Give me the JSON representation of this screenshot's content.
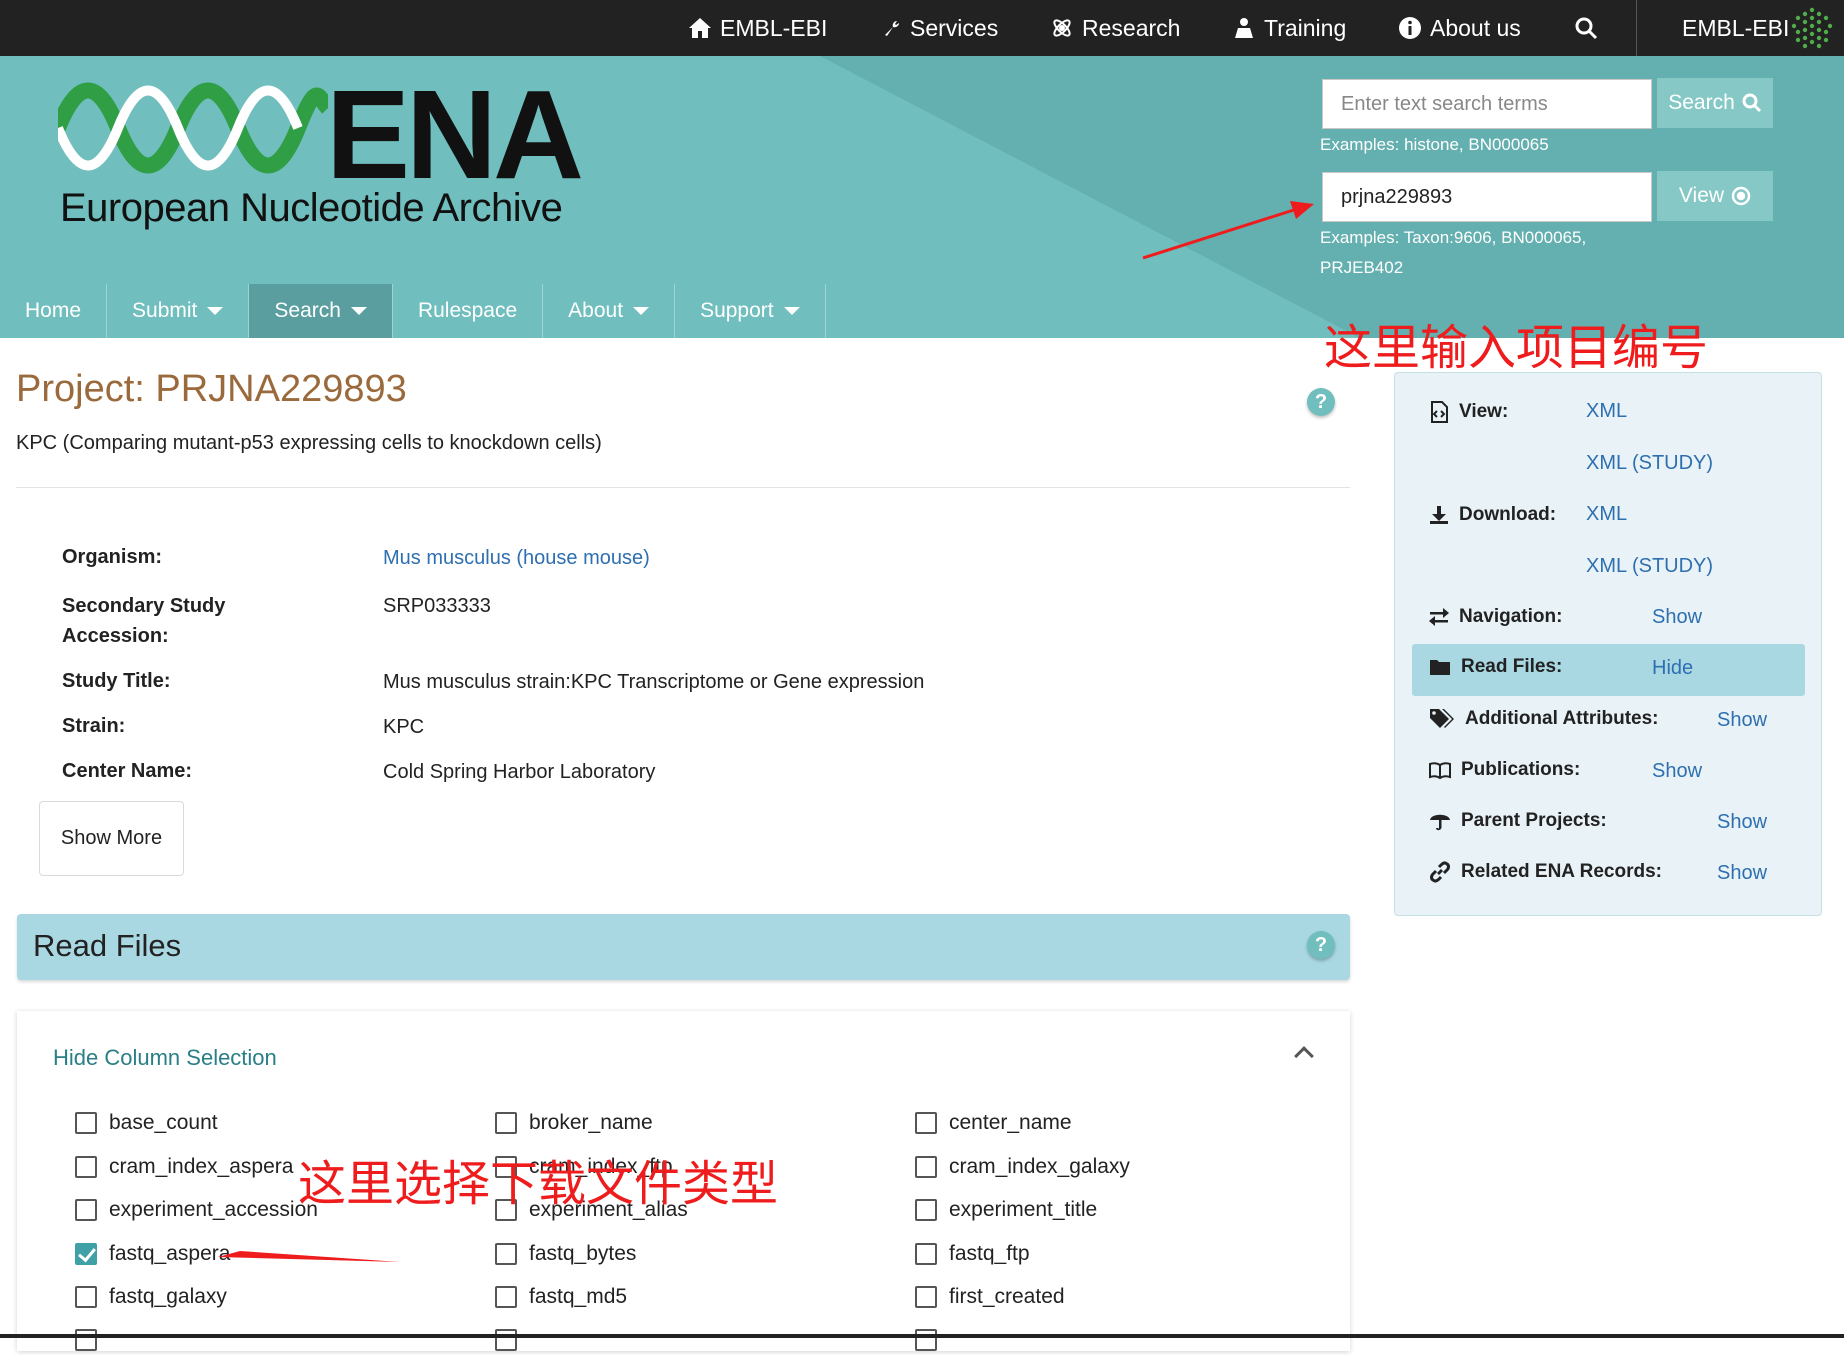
{
  "topbar": {
    "items": [
      {
        "label": "EMBL-EBI",
        "icon": "home-icon"
      },
      {
        "label": "Services",
        "icon": "wrench-icon"
      },
      {
        "label": "Research",
        "icon": "atom-icon"
      },
      {
        "label": "Training",
        "icon": "trainer-icon"
      },
      {
        "label": "About us",
        "icon": "info-icon"
      }
    ],
    "search_icon": "search-icon",
    "brand": "EMBL-EBI"
  },
  "masthead": {
    "logo_text": "ENA",
    "logo_subtitle": "European Nucleotide Archive",
    "search": {
      "placeholder": "Enter text search terms",
      "value": "",
      "button": "Search",
      "examples": "Examples: histone, BN000065"
    },
    "view": {
      "value": "prjna229893",
      "button": "View",
      "examples_line1": "Examples: Taxon:9606, BN000065,",
      "examples_line2": "PRJEB402"
    },
    "nav": [
      {
        "label": "Home",
        "dropdown": false
      },
      {
        "label": "Submit",
        "dropdown": true
      },
      {
        "label": "Search",
        "dropdown": true,
        "active": true
      },
      {
        "label": "Rulespace",
        "dropdown": false
      },
      {
        "label": "About",
        "dropdown": true
      },
      {
        "label": "Support",
        "dropdown": true
      }
    ]
  },
  "annotations": {
    "project_input": "这里输入项目编号",
    "file_type": "这里选择下载文件类型",
    "color": "#ee1c1c"
  },
  "project": {
    "title": "Project: PRJNA229893",
    "description": "KPC (Comparing mutant-p53 expressing cells to knockdown cells)",
    "details": [
      {
        "label": "Organism:",
        "value": "Mus musculus (house mouse)",
        "link": true
      },
      {
        "label_line1": "Secondary Study",
        "label_line2": "Accession:",
        "value": "SRP033333"
      },
      {
        "label": "Study Title:",
        "value": "Mus musculus strain:KPC Transcriptome or Gene expression"
      },
      {
        "label": "Strain:",
        "value": "KPC"
      },
      {
        "label": "Center Name:",
        "value": "Cold Spring Harbor Laboratory"
      }
    ],
    "show_more": "Show More"
  },
  "read_files": {
    "title": "Read Files",
    "help": "?",
    "column_toggle": "Hide Column Selection",
    "columns": [
      {
        "name": "base_count",
        "checked": false
      },
      {
        "name": "broker_name",
        "checked": false
      },
      {
        "name": "center_name",
        "checked": false
      },
      {
        "name": "cram_index_aspera",
        "checked": false
      },
      {
        "name": "cram_index_ftp",
        "checked": false
      },
      {
        "name": "cram_index_galaxy",
        "checked": false
      },
      {
        "name": "experiment_accession",
        "checked": false
      },
      {
        "name": "experiment_alias",
        "checked": false
      },
      {
        "name": "experiment_title",
        "checked": false
      },
      {
        "name": "fastq_aspera",
        "checked": true
      },
      {
        "name": "fastq_bytes",
        "checked": false
      },
      {
        "name": "fastq_ftp",
        "checked": false
      },
      {
        "name": "fastq_galaxy",
        "checked": false
      },
      {
        "name": "fastq_md5",
        "checked": false
      },
      {
        "name": "first_created",
        "checked": false
      }
    ]
  },
  "sidebar": {
    "help": "?",
    "view_label": "View:",
    "view_links": [
      "XML",
      "XML (STUDY)"
    ],
    "download_label": "Download:",
    "download_links": [
      "XML",
      "XML (STUDY)"
    ],
    "rows": [
      {
        "label": "Navigation:",
        "action": "Show",
        "icon": "exchange-icon"
      },
      {
        "label": "Read Files:",
        "action": "Hide",
        "icon": "folder-icon",
        "active": true
      },
      {
        "label": "Additional Attributes:",
        "action": "Show",
        "icon": "tags-icon"
      },
      {
        "label": "Publications:",
        "action": "Show",
        "icon": "book-icon"
      },
      {
        "label": "Parent Projects:",
        "action": "Show",
        "icon": "umbrella-icon"
      },
      {
        "label": "Related ENA Records:",
        "action": "Show",
        "icon": "link-icon"
      }
    ]
  },
  "colors": {
    "topbar": "#222222",
    "masthead": "#70bebd",
    "title": "#9b6a3c",
    "link": "#2e6fb0",
    "highlight": "#a9d8e3"
  }
}
